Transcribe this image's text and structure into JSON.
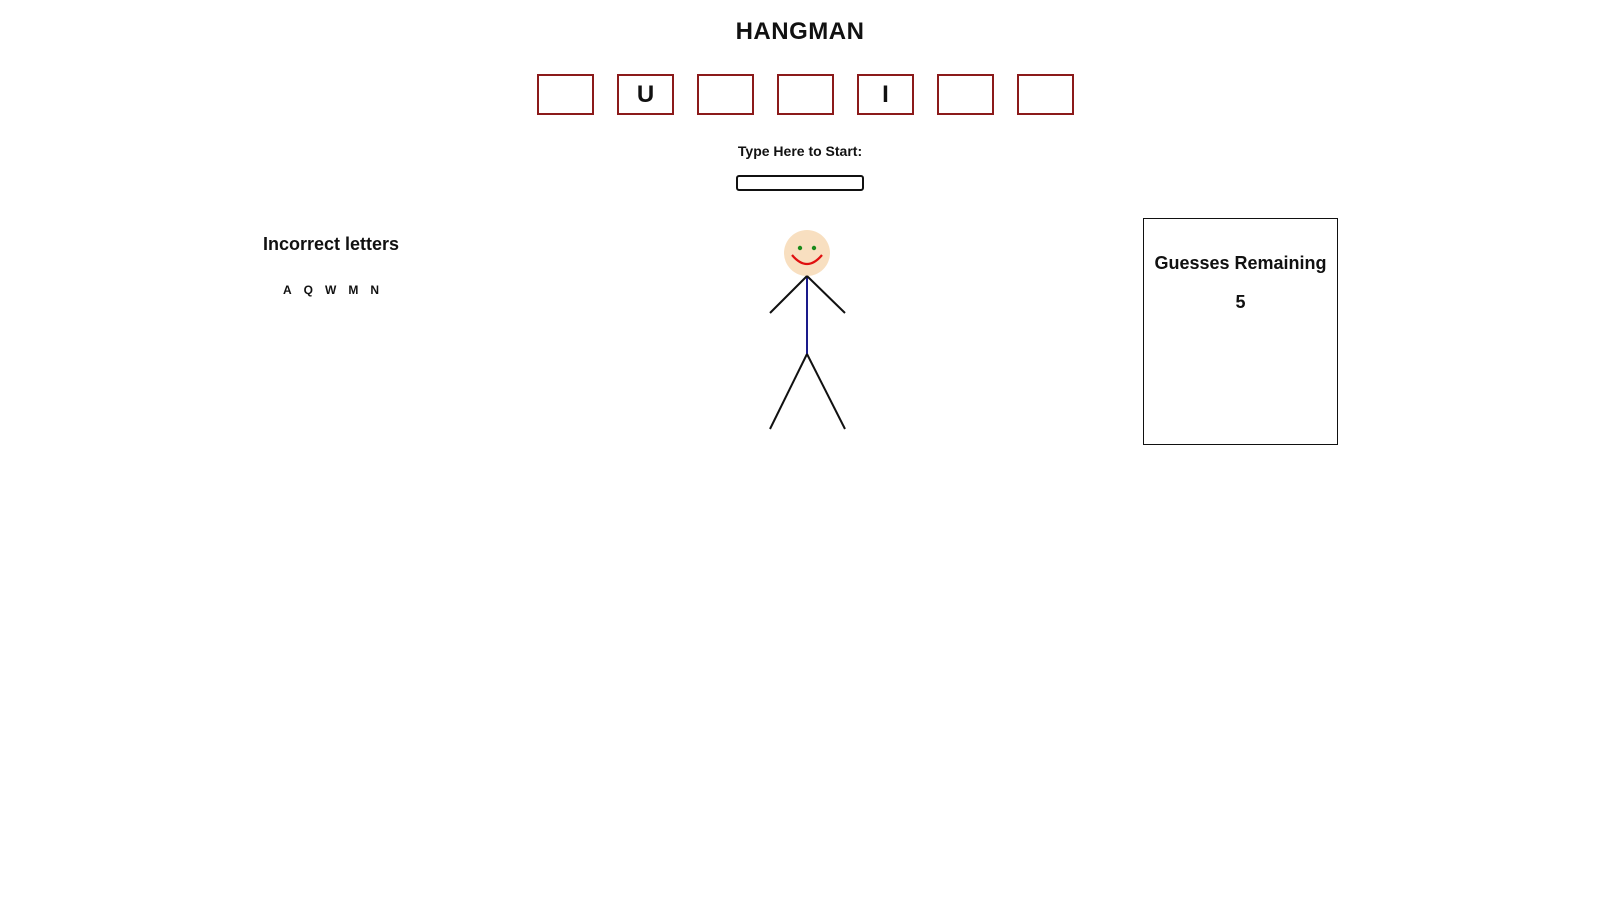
{
  "game": {
    "title": "HANGMAN"
  },
  "word": {
    "slots": [
      "",
      "U",
      "",
      "",
      "I",
      "",
      ""
    ]
  },
  "input": {
    "prompt": "Type Here to Start:",
    "value": ""
  },
  "incorrect": {
    "title": "Incorrect letters",
    "letters": [
      "A",
      "Q",
      "W",
      "M",
      "N"
    ]
  },
  "guesses": {
    "title": "Guesses Remaining",
    "count": "5"
  },
  "colors": {
    "box_border": "#8b1a1a",
    "face": "#f8dfc0",
    "eyes": "#1a8a1a",
    "smile": "#e01010",
    "body": "#1a1a8a",
    "limbs": "#111111"
  },
  "icons": {
    "figure": "stick-figure-icon"
  }
}
